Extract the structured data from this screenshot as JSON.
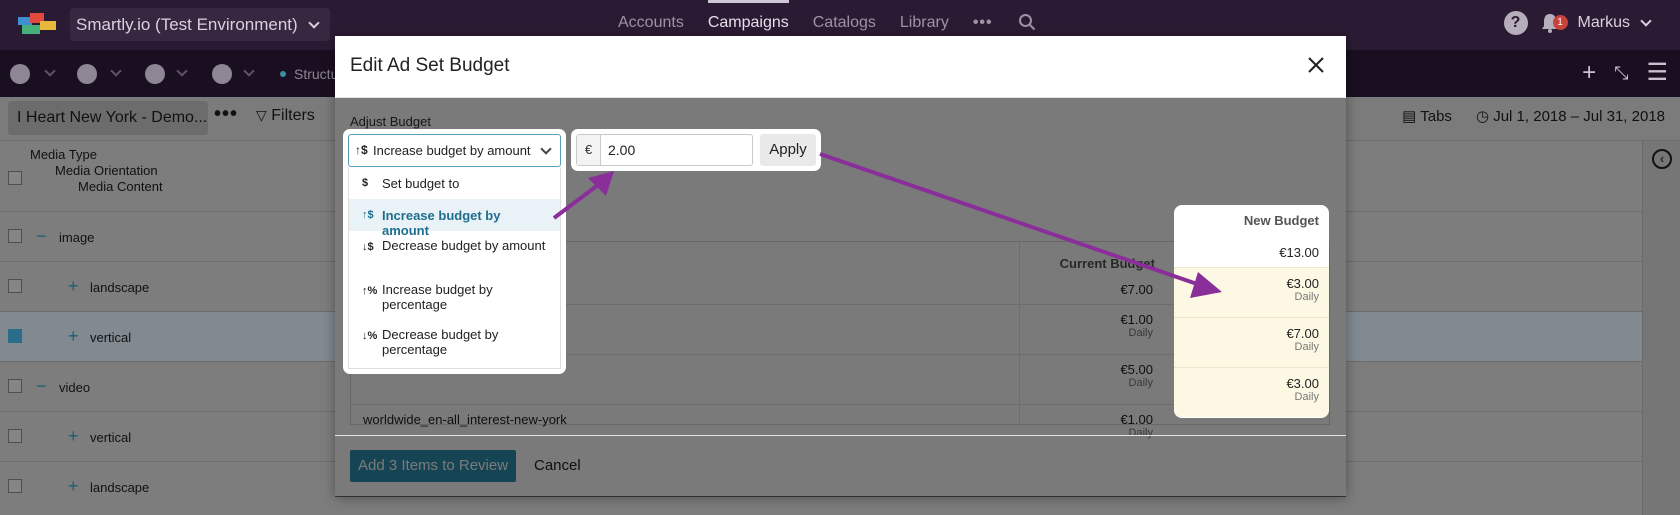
{
  "topnav": {
    "org_name": "Smartly.io (Test Environment)",
    "links": [
      "Accounts",
      "Campaigns",
      "Catalogs",
      "Library"
    ],
    "active_link": "Campaigns",
    "more": "•••",
    "notification_count": "1",
    "user": "Markus"
  },
  "subnav": {
    "structure_label": "Structu"
  },
  "toolbar": {
    "campaign": "I Heart New York - Demo...",
    "more": "•••",
    "filters": "Filters",
    "tabs": "Tabs",
    "date_range": "Jul 1, 2018 – Jul 31, 2018"
  },
  "tree": {
    "header": [
      "Media Type",
      "Media Orientation",
      "Media Content"
    ],
    "rows": [
      {
        "sign": "−",
        "label": "image"
      },
      {
        "sign": "+",
        "label": "landscape"
      },
      {
        "sign": "+",
        "label": "vertical",
        "checked": true
      },
      {
        "sign": "−",
        "label": "video"
      },
      {
        "sign": "+",
        "label": "vertical"
      },
      {
        "sign": "+",
        "label": "landscape"
      }
    ]
  },
  "modal": {
    "title": "Edit Ad Set Budget",
    "adjust_label": "Adjust Budget",
    "select_value": "Increase budget by amount",
    "options": [
      {
        "icon": "$",
        "label": "Set budget to"
      },
      {
        "icon": "↑$",
        "label": "Increase budget by amount",
        "active": true
      },
      {
        "icon": "↓$",
        "label": "Decrease budget by amount"
      },
      {
        "icon": "↑%",
        "label": "Increase budget by percentage"
      },
      {
        "icon": "↓%",
        "label": "Decrease budget by percentage"
      }
    ],
    "currency": "€",
    "amount": "2.00",
    "apply": "Apply",
    "columns": {
      "current": "Current Budget",
      "new": "New Budget"
    },
    "rows": [
      {
        "name": "",
        "current": "€7.00",
        "current_period": "",
        "new": "€13.00",
        "new_period": ""
      },
      {
        "name": "",
        "current": "€1.00",
        "current_period": "Daily",
        "new": "€3.00",
        "new_period": "Daily"
      },
      {
        "name": "",
        "current": "€5.00",
        "current_period": "Daily",
        "new": "€7.00",
        "new_period": "Daily"
      },
      {
        "name": "worldwide_en-all_interest-new-york",
        "current": "€1.00",
        "current_period": "Daily",
        "new": "€3.00",
        "new_period": "Daily"
      }
    ],
    "add_button": "Add 3 Items to Review",
    "cancel": "Cancel"
  },
  "colors": {
    "accent": "#2c8fb0",
    "annotation_arrow": "#8a2e9a",
    "new_budget_bg": "#fdf8e3",
    "nav_bg": "#2b1a33"
  }
}
